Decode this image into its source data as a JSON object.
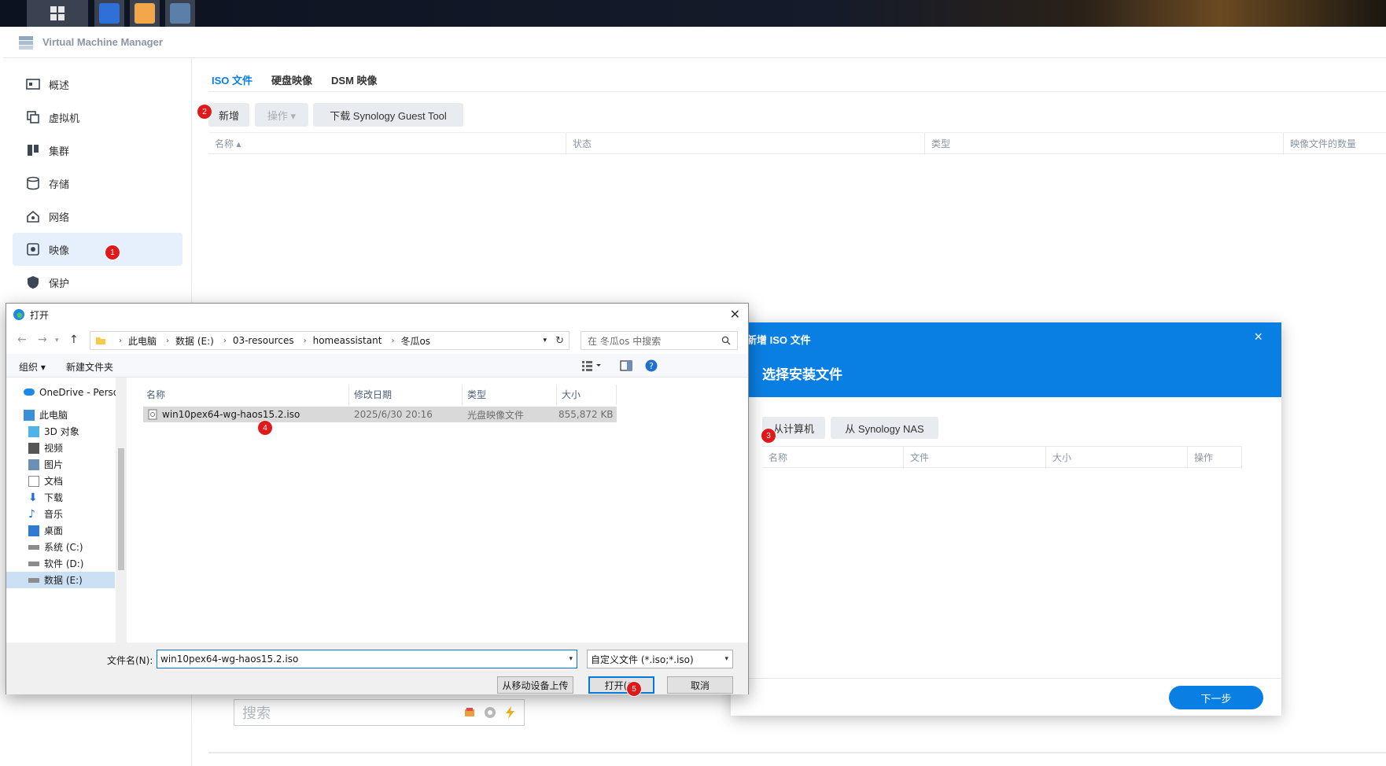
{
  "taskbar": {
    "apps": [
      "start-icon",
      "vmm-app-icon",
      "synology-app-icon",
      "server-app-icon"
    ]
  },
  "vmm": {
    "title": "Virtual Machine Manager",
    "sidebar": [
      {
        "label": "概述",
        "icon": "overview-icon"
      },
      {
        "label": "虚拟机",
        "icon": "vm-icon"
      },
      {
        "label": "集群",
        "icon": "cluster-icon"
      },
      {
        "label": "存储",
        "icon": "storage-icon"
      },
      {
        "label": "网络",
        "icon": "network-icon"
      },
      {
        "label": "映像",
        "icon": "image-icon"
      },
      {
        "label": "保护",
        "icon": "shield-icon"
      }
    ],
    "tabs": [
      "ISO 文件",
      "硬盘映像",
      "DSM 映像"
    ],
    "toolbar": {
      "add": "新增",
      "action": "操作 ▾",
      "download": "下载 Synology Guest Tool"
    },
    "columns": [
      "名称 ▴",
      "状态",
      "类型",
      "映像文件的数量"
    ],
    "search_placeholder": "搜索"
  },
  "steps": [
    "1",
    "2",
    "3",
    "4",
    "5"
  ],
  "modal": {
    "title_small": "新增 ISO 文件",
    "close": "×",
    "title": "选择安装文件",
    "from_computer": "从计算机",
    "from_nas": "从 Synology NAS",
    "columns": [
      "名称",
      "文件",
      "大小",
      "操作"
    ],
    "next": "下一步"
  },
  "open_dialog": {
    "title": "打开",
    "close": "✕",
    "breadcrumb": [
      "此电脑",
      "数据 (E:)",
      "03-resources",
      "homeassistant",
      "冬瓜os"
    ],
    "search_placeholder": "在 冬瓜os 中搜索",
    "organize": "组织 ▾",
    "new_folder": "新建文件夹",
    "tree": [
      "OneDrive - Perso",
      "此电脑",
      "3D 对象",
      "视频",
      "图片",
      "文档",
      "下载",
      "音乐",
      "桌面",
      "系统 (C:)",
      "软件 (D:)",
      "数据 (E:)"
    ],
    "columns": [
      "名称",
      "修改日期",
      "类型",
      "大小"
    ],
    "file": {
      "name": "win10pex64-wg-haos15.2.iso",
      "date": "2025/6/30 20:16",
      "type": "光盘映像文件",
      "size": "855,872 KB"
    },
    "filename_label": "文件名(N):",
    "filename_value": "win10pex64-wg-haos15.2.iso",
    "filetype": "自定义文件 (*.iso;*.iso)",
    "upload_btn": "从移动设备上传",
    "open_btn": "打开(O)",
    "cancel_btn": "取消"
  }
}
